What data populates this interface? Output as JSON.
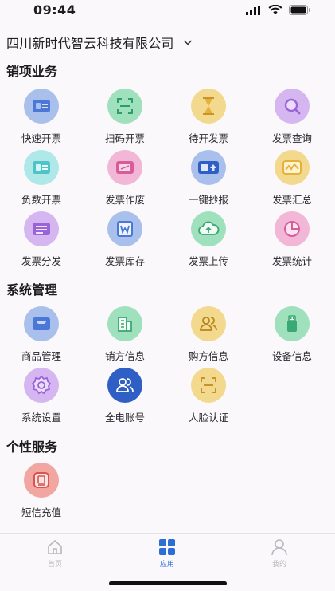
{
  "status": {
    "time": "09:44"
  },
  "header": {
    "company": "四川新时代智云科技有限公司"
  },
  "colors": {
    "blue": "#4b78d6",
    "blue_bg": "#a9c0ec",
    "green": "#4cbf86",
    "green_bg": "#9fe0bd",
    "yellow": "#e5b13a",
    "yellow_bg": "#f3d98e",
    "purple": "#9a63d8",
    "purple_bg": "#d5b6f1",
    "cyan": "#4fc3c7",
    "cyan_bg": "#aee8e8",
    "pink": "#d95c9a",
    "pink_bg": "#f2b6d6",
    "red": "#d9534f",
    "red_bg": "#f1a6a2",
    "deepblue": "#2f5fc4",
    "accent": "#2b6ed6"
  },
  "sections": [
    {
      "title": "销项业务",
      "items": [
        {
          "label": "快速开票",
          "icon": "invoice-card-icon"
        },
        {
          "label": "扫码开票",
          "icon": "scan-icon"
        },
        {
          "label": "待开发票",
          "icon": "hourglass-icon"
        },
        {
          "label": "发票查询",
          "icon": "magnifier-icon"
        },
        {
          "label": "负数开票",
          "icon": "negative-invoice-icon"
        },
        {
          "label": "发票作废",
          "icon": "void-invoice-icon"
        },
        {
          "label": "一键抄报",
          "icon": "report-upload-icon"
        },
        {
          "label": "发票汇总",
          "icon": "summary-chart-icon"
        },
        {
          "label": "发票分发",
          "icon": "distribute-icon"
        },
        {
          "label": "发票库存",
          "icon": "stock-icon"
        },
        {
          "label": "发票上传",
          "icon": "cloud-upload-icon"
        },
        {
          "label": "发票统计",
          "icon": "pie-chart-icon"
        }
      ]
    },
    {
      "title": "系统管理",
      "items": [
        {
          "label": "商品管理",
          "icon": "box-icon"
        },
        {
          "label": "销方信息",
          "icon": "building-icon"
        },
        {
          "label": "购方信息",
          "icon": "users-icon"
        },
        {
          "label": "设备信息",
          "icon": "usb-icon"
        },
        {
          "label": "系统设置",
          "icon": "gear-icon"
        },
        {
          "label": "全电账号",
          "icon": "account-group-icon"
        },
        {
          "label": "人脸认证",
          "icon": "face-scan-icon"
        }
      ]
    },
    {
      "title": "个性服务",
      "items": [
        {
          "label": "短信充值",
          "icon": "sms-icon"
        }
      ]
    }
  ],
  "tabbar": [
    {
      "label": "首页",
      "icon": "home-icon",
      "active": false
    },
    {
      "label": "应用",
      "icon": "apps-icon",
      "active": true
    },
    {
      "label": "我的",
      "icon": "profile-icon",
      "active": false
    }
  ]
}
